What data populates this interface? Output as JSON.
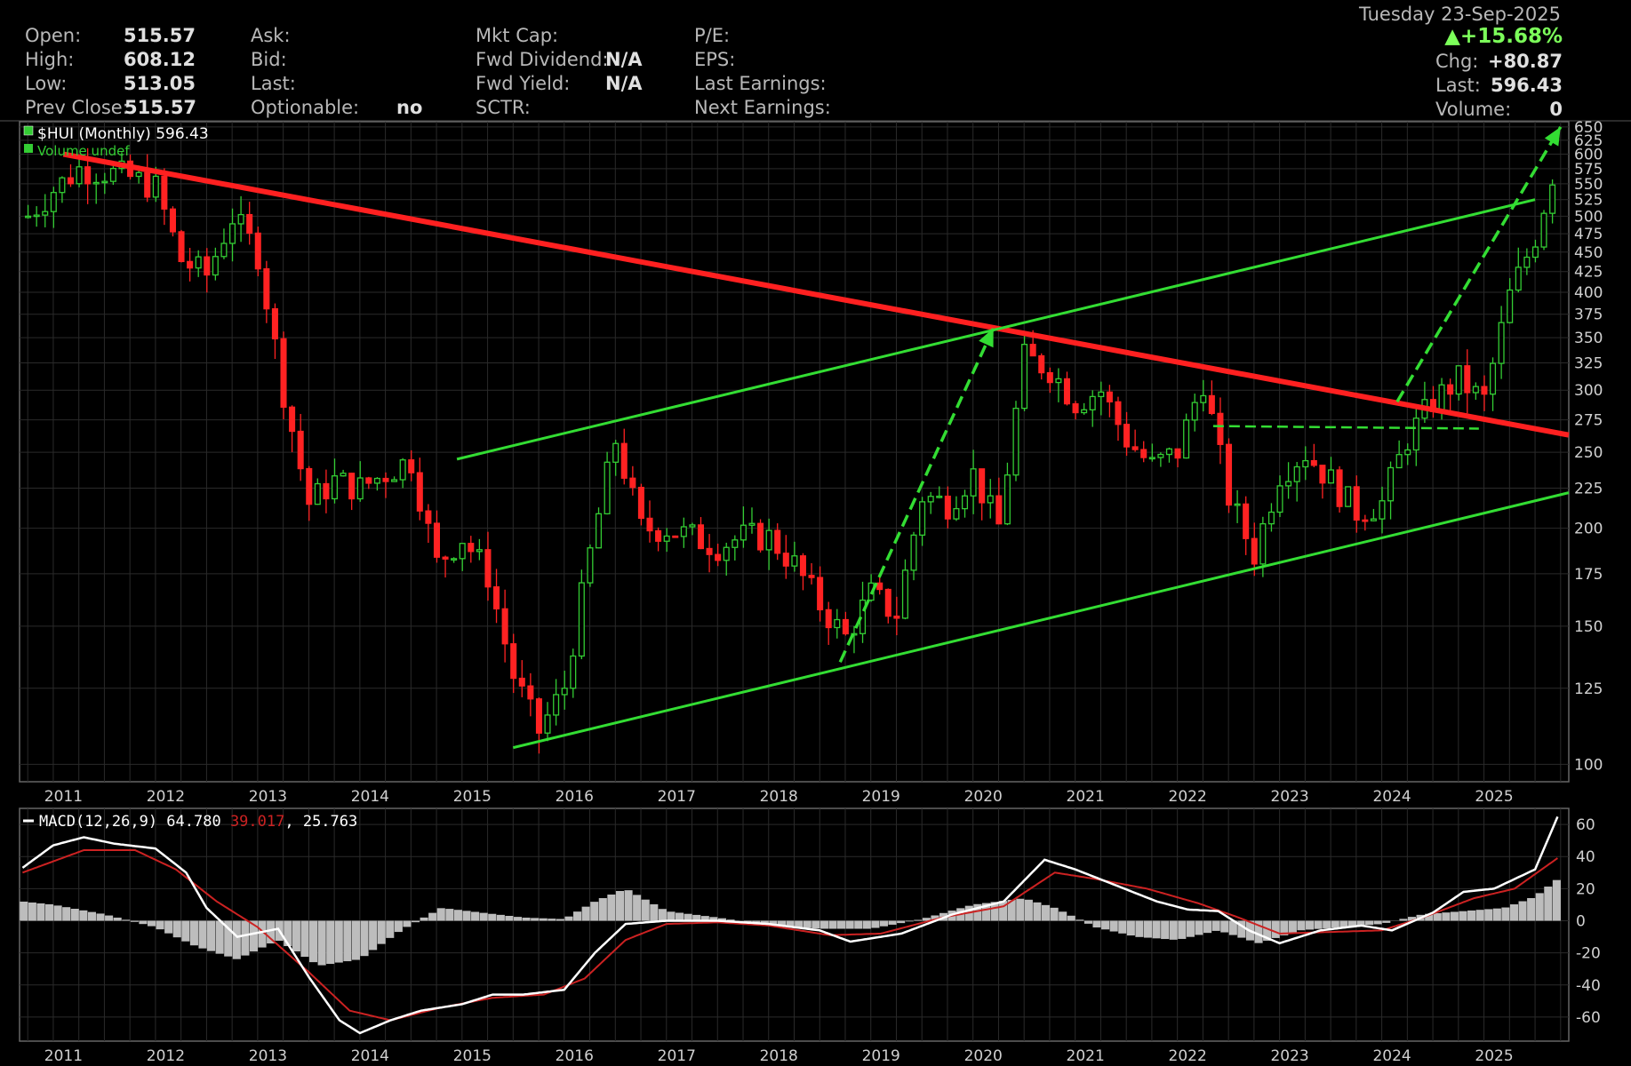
{
  "header": {
    "date": "Tuesday 23-Sep-2025",
    "open_label": "Open:",
    "open_value": "515.57",
    "high_label": "High:",
    "high_value": "608.12",
    "low_label": "Low:",
    "low_value": "513.05",
    "prev_close_label": "Prev Close:",
    "prev_close_value": "515.57",
    "ask_label": "Ask:",
    "bid_label": "Bid:",
    "last_label": "Last:",
    "optionable_label": "Optionable:",
    "optionable_value": "no",
    "mkt_cap_label": "Mkt Cap:",
    "fwd_dividend_label": "Fwd Dividend:",
    "fwd_dividend_value": "N/A",
    "fwd_yield_label": "Fwd Yield:",
    "fwd_yield_value": "N/A",
    "sctr_label": "SCTR:",
    "pe_label": "P/E:",
    "eps_label": "EPS:",
    "last_earnings_label": "Last Earnings:",
    "next_earnings_label": "Next Earnings:",
    "change_pct": "+15.68%",
    "chg_label": "Chg:",
    "chg_value": "+80.87",
    "last_price_label": "Last:",
    "last_price_value": "596.43",
    "volume_label": "Volume:",
    "volume_value": "0"
  },
  "colors": {
    "background": "#000000",
    "grid": "#2a2a2a",
    "up_candle": "#33cc33",
    "down_candle": "#ff2222",
    "resistance_line": "#ff2020",
    "channel_line": "#33dd33",
    "macd_line": "#ffffff",
    "signal_line": "#cc2222",
    "histogram": "#bdbdbd"
  },
  "chart_data": [
    {
      "type": "candlestick",
      "legend": [
        {
          "name": "$HUI (Monthly) 596.43",
          "color": "#ffffff"
        },
        {
          "name": "Volume undef",
          "color": "#33cc33"
        }
      ],
      "y_scale": "log",
      "ylim": [
        95,
        660
      ],
      "y_ticks": [
        100,
        125,
        150,
        175,
        200,
        225,
        250,
        275,
        300,
        325,
        350,
        375,
        400,
        425,
        450,
        475,
        500,
        525,
        550,
        575,
        600,
        625,
        650
      ],
      "x_ticks": [
        "2011",
        "2012",
        "2013",
        "2014",
        "2015",
        "2016",
        "2017",
        "2018",
        "2019",
        "2020",
        "2021",
        "2022",
        "2023",
        "2024",
        "2025"
      ],
      "x_range": [
        2010.67,
        2025.83
      ],
      "monthly_closes": [
        {
          "year": 2010.75,
          "close": 500
        },
        {
          "year": 2011.0,
          "close": 540
        },
        {
          "year": 2011.25,
          "close": 575
        },
        {
          "year": 2011.5,
          "close": 570
        },
        {
          "year": 2011.75,
          "close": 560
        },
        {
          "year": 2012.0,
          "close": 545
        },
        {
          "year": 2012.25,
          "close": 440
        },
        {
          "year": 2012.5,
          "close": 420
        },
        {
          "year": 2012.75,
          "close": 500
        },
        {
          "year": 2013.0,
          "close": 450
        },
        {
          "year": 2013.25,
          "close": 300
        },
        {
          "year": 2013.5,
          "close": 215
        },
        {
          "year": 2013.75,
          "close": 230
        },
        {
          "year": 2014.0,
          "close": 225
        },
        {
          "year": 2014.25,
          "close": 235
        },
        {
          "year": 2014.5,
          "close": 245
        },
        {
          "year": 2014.75,
          "close": 180
        },
        {
          "year": 2015.0,
          "close": 195
        },
        {
          "year": 2015.25,
          "close": 175
        },
        {
          "year": 2015.5,
          "close": 130
        },
        {
          "year": 2015.75,
          "close": 110
        },
        {
          "year": 2016.0,
          "close": 125
        },
        {
          "year": 2016.25,
          "close": 185
        },
        {
          "year": 2016.5,
          "close": 260
        },
        {
          "year": 2016.75,
          "close": 200
        },
        {
          "year": 2017.0,
          "close": 200
        },
        {
          "year": 2017.25,
          "close": 195
        },
        {
          "year": 2017.5,
          "close": 190
        },
        {
          "year": 2017.75,
          "close": 195
        },
        {
          "year": 2018.0,
          "close": 195
        },
        {
          "year": 2018.25,
          "close": 180
        },
        {
          "year": 2018.5,
          "close": 160
        },
        {
          "year": 2018.75,
          "close": 145
        },
        {
          "year": 2019.0,
          "close": 165
        },
        {
          "year": 2019.25,
          "close": 155
        },
        {
          "year": 2019.5,
          "close": 220
        },
        {
          "year": 2019.75,
          "close": 215
        },
        {
          "year": 2020.0,
          "close": 235
        },
        {
          "year": 2020.25,
          "close": 200
        },
        {
          "year": 2020.5,
          "close": 330
        },
        {
          "year": 2020.75,
          "close": 320
        },
        {
          "year": 2021.0,
          "close": 290
        },
        {
          "year": 2021.25,
          "close": 300
        },
        {
          "year": 2021.5,
          "close": 260
        },
        {
          "year": 2021.75,
          "close": 240
        },
        {
          "year": 2022.0,
          "close": 250
        },
        {
          "year": 2022.25,
          "close": 310
        },
        {
          "year": 2022.5,
          "close": 220
        },
        {
          "year": 2022.75,
          "close": 185
        },
        {
          "year": 2023.0,
          "close": 235
        },
        {
          "year": 2023.25,
          "close": 250
        },
        {
          "year": 2023.5,
          "close": 230
        },
        {
          "year": 2023.75,
          "close": 210
        },
        {
          "year": 2024.0,
          "close": 215
        },
        {
          "year": 2024.25,
          "close": 260
        },
        {
          "year": 2024.5,
          "close": 290
        },
        {
          "year": 2024.75,
          "close": 310
        },
        {
          "year": 2025.0,
          "close": 290
        },
        {
          "year": 2025.25,
          "close": 395
        },
        {
          "year": 2025.5,
          "close": 470
        },
        {
          "year": 2025.72,
          "close": 596.43
        }
      ],
      "trendlines": [
        {
          "name": "resistance",
          "color": "red",
          "from": [
            2011.1,
            600
          ],
          "to": [
            2025.83,
            263
          ]
        },
        {
          "name": "channel-upper",
          "color": "green",
          "from": [
            2014.95,
            245
          ],
          "to": [
            2025.5,
            525
          ]
        },
        {
          "name": "channel-lower",
          "color": "green",
          "from": [
            2015.5,
            105
          ],
          "to": [
            2025.83,
            222
          ]
        },
        {
          "name": "support",
          "color": "green",
          "dashed": true,
          "from": [
            2022.35,
            270
          ],
          "to": [
            2024.95,
            268
          ]
        }
      ],
      "arrows": [
        {
          "from": [
            2018.7,
            135
          ],
          "to": [
            2020.2,
            360
          ]
        },
        {
          "from": [
            2024.15,
            290
          ],
          "to": [
            2025.75,
            650
          ]
        }
      ]
    },
    {
      "type": "line",
      "legend": [
        {
          "name": "MACD(12,26,9) 64.780",
          "color": "#ffffff"
        },
        {
          "name": "39.017",
          "color": "#cc2222"
        },
        {
          "name": "25.763",
          "color": "#ffffff"
        }
      ],
      "ylim": [
        -75,
        70
      ],
      "y_ticks": [
        60,
        40,
        20,
        0,
        -20,
        -40,
        -60
      ],
      "x_ticks": [
        "2011",
        "2012",
        "2013",
        "2014",
        "2015",
        "2016",
        "2017",
        "2018",
        "2019",
        "2020",
        "2021",
        "2022",
        "2023",
        "2024",
        "2025"
      ],
      "series": [
        {
          "name": "MACD(12,26,9)",
          "x": [
            2010.7,
            2011.0,
            2011.3,
            2011.6,
            2012.0,
            2012.3,
            2012.5,
            2012.8,
            2013.2,
            2013.5,
            2013.8,
            2014.0,
            2014.3,
            2014.6,
            2015.0,
            2015.3,
            2015.6,
            2016.0,
            2016.3,
            2016.6,
            2017.0,
            2017.5,
            2018.0,
            2018.5,
            2018.8,
            2019.3,
            2019.8,
            2020.3,
            2020.7,
            2021.0,
            2021.4,
            2021.8,
            2022.1,
            2022.4,
            2022.7,
            2023.0,
            2023.4,
            2023.8,
            2024.1,
            2024.5,
            2024.8,
            2025.1,
            2025.5,
            2025.72
          ],
          "values": [
            33,
            47,
            52,
            48,
            45,
            30,
            8,
            -10,
            -5,
            -35,
            -62,
            -70,
            -62,
            -56,
            -52,
            -46,
            -46,
            -43,
            -20,
            -2,
            0,
            0,
            -2,
            -6,
            -13,
            -8,
            4,
            12,
            38,
            32,
            22,
            12,
            7,
            6,
            -6,
            -14,
            -6,
            -3,
            -6,
            5,
            18,
            20,
            32,
            64.78
          ]
        },
        {
          "name": "Signal",
          "x": [
            2010.7,
            2011.3,
            2011.8,
            2012.2,
            2012.6,
            2013.0,
            2013.5,
            2013.9,
            2014.3,
            2014.8,
            2015.3,
            2015.8,
            2016.2,
            2016.6,
            2017.0,
            2017.5,
            2018.0,
            2018.6,
            2019.1,
            2019.7,
            2020.3,
            2020.8,
            2021.2,
            2021.7,
            2022.2,
            2022.6,
            2023.0,
            2023.5,
            2024.0,
            2024.4,
            2024.9,
            2025.3,
            2025.72
          ],
          "values": [
            30,
            44,
            44,
            32,
            12,
            -4,
            -32,
            -56,
            -62,
            -54,
            -48,
            -46,
            -36,
            -12,
            -2,
            -1,
            -3,
            -9,
            -8,
            2,
            9,
            30,
            26,
            20,
            11,
            2,
            -8,
            -7,
            -6,
            2,
            14,
            20,
            39.017
          ]
        },
        {
          "name": "Histogram",
          "x": [
            2010.7,
            2011.0,
            2011.5,
            2012.0,
            2012.4,
            2012.8,
            2013.2,
            2013.6,
            2014.0,
            2014.4,
            2014.8,
            2015.2,
            2015.6,
            2016.0,
            2016.3,
            2016.6,
            2017.0,
            2017.5,
            2018.0,
            2018.5,
            2019.0,
            2019.5,
            2020.0,
            2020.5,
            2020.8,
            2021.2,
            2021.6,
            2022.0,
            2022.4,
            2022.8,
            2023.2,
            2023.6,
            2024.0,
            2024.4,
            2024.8,
            2025.2,
            2025.5,
            2025.72
          ],
          "values": [
            12,
            10,
            4,
            -4,
            -16,
            -24,
            -12,
            -28,
            -24,
            -6,
            8,
            5,
            2,
            1,
            12,
            20,
            6,
            2,
            -3,
            -5,
            -5,
            1,
            10,
            14,
            8,
            -4,
            -10,
            -12,
            -6,
            -14,
            -6,
            -4,
            -2,
            4,
            6,
            8,
            15,
            25.763
          ]
        }
      ]
    }
  ]
}
